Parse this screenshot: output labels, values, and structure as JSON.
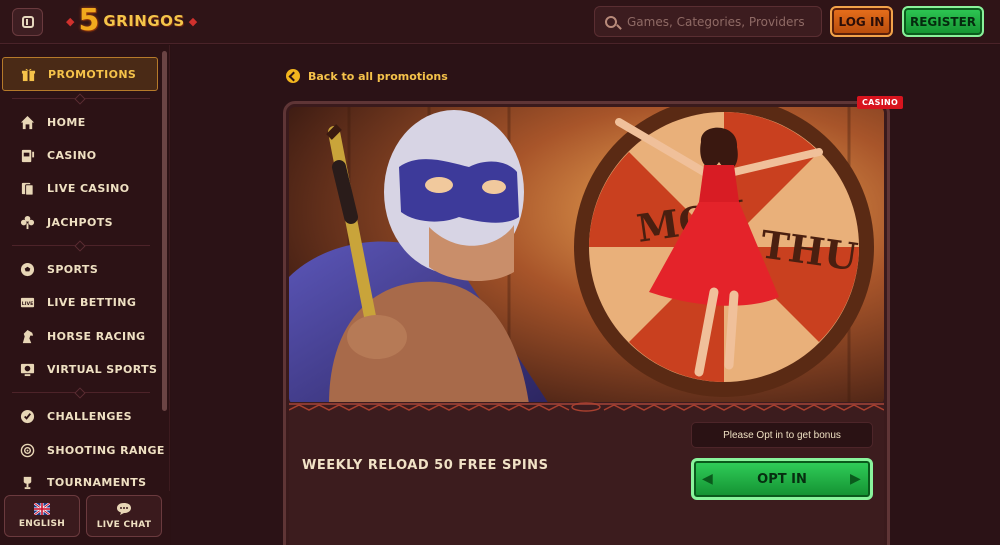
{
  "header": {
    "logo_number": "5",
    "logo_text": "GRINGOS",
    "search_placeholder": "Games, Categories, Providers",
    "login_label": "LOG IN",
    "register_label": "REGISTER"
  },
  "sidebar": {
    "promotions_label": "PROMOTIONS",
    "items": [
      {
        "label": "HOME",
        "icon": "home-icon"
      },
      {
        "label": "CASINO",
        "icon": "slot-machine-icon"
      },
      {
        "label": "LIVE CASINO",
        "icon": "cards-icon"
      },
      {
        "label": "JACHPOTS",
        "icon": "clover-icon"
      },
      {
        "label": "SPORTS",
        "icon": "soccer-ball-icon"
      },
      {
        "label": "LIVE BETTING",
        "icon": "live-icon"
      },
      {
        "label": "HORSE RACING",
        "icon": "horse-icon"
      },
      {
        "label": "VIRTUAL SPORTS",
        "icon": "virtual-sports-icon"
      },
      {
        "label": "CHALLENGES",
        "icon": "challenge-icon"
      },
      {
        "label": "SHOOTING RANGE",
        "icon": "target-icon"
      },
      {
        "label": "TOURNAMENTS",
        "icon": "trophy-icon"
      }
    ],
    "language_label": "ENGLISH",
    "live_chat_label": "LIVE CHAT"
  },
  "main": {
    "back_link": "Back to all promotions",
    "badge": "CASINO",
    "banner_text_left": "MON",
    "banner_text_right": "THU",
    "promo_title": "WEEKLY RELOAD 50 FREE SPINS",
    "optin_note": "Please Opt in to get bonus",
    "optin_button": "OPT IN"
  },
  "colors": {
    "accent_gold": "#f5c24a",
    "login_orange": "#e8701c",
    "register_green": "#2fc955",
    "badge_red": "#d8141e",
    "background": "#2a1114"
  }
}
